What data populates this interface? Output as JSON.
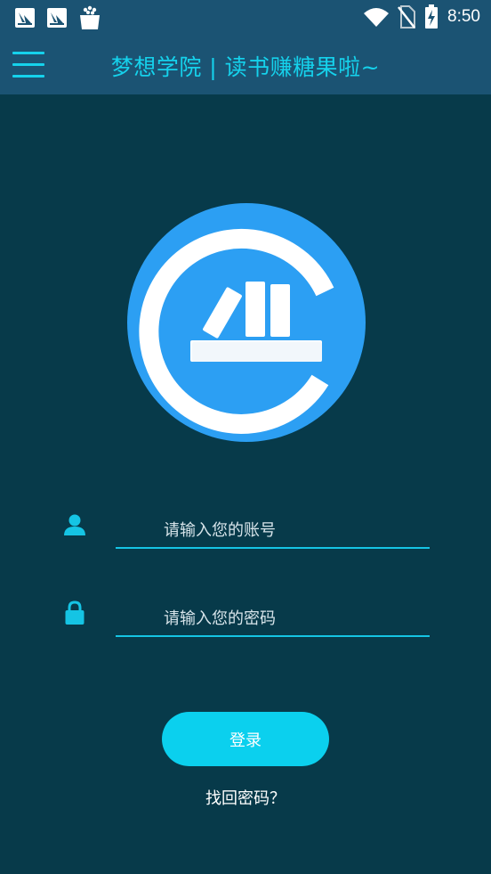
{
  "status_bar": {
    "time": "8:50",
    "icons": [
      "notification-app-icon",
      "notification-app-icon",
      "shopping-bag-icon",
      "wifi-icon",
      "no-sim-icon",
      "battery-charging-icon"
    ]
  },
  "app_bar": {
    "title": "梦想学院 | 读书赚糖果啦~",
    "menu_icon": "hamburger-menu-icon"
  },
  "logo": {
    "icon": "book-shelf-logo-icon"
  },
  "login_form": {
    "account_placeholder": "请输入您的账号",
    "account_value": "",
    "account_icon": "user-icon",
    "password_placeholder": "请输入您的密码",
    "password_value": "",
    "password_icon": "lock-icon",
    "login_label": "登录",
    "forgot_label": "找回密码？"
  },
  "colors": {
    "background": "#073a4a",
    "bar": "#1b5373",
    "accent": "#15d2ec",
    "button": "#0bd0ee",
    "logo_blue": "#2c9ff3"
  }
}
